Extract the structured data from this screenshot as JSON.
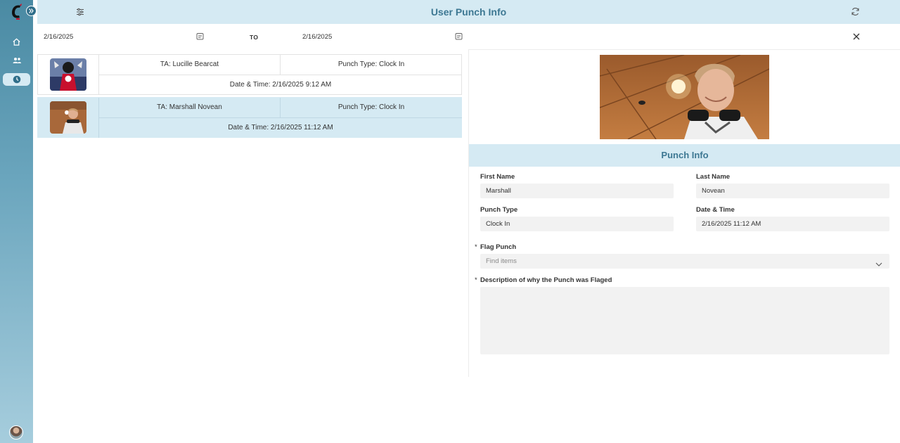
{
  "header": {
    "title": "User Punch Info"
  },
  "date_range": {
    "start": "2/16/2025",
    "to_label": "TO",
    "end": "2/16/2025"
  },
  "punches": [
    {
      "ta": "TA: Lucille Bearcat",
      "punch_type": "Punch Type: Clock In",
      "date_time": "Date & Time: 2/16/2025 9:12 AM",
      "selected": false
    },
    {
      "ta": "TA: Marshall Novean",
      "punch_type": "Punch Type: Clock In",
      "date_time": "Date & Time: 2/16/2025 11:12 AM",
      "selected": true
    }
  ],
  "detail": {
    "section_title": "Punch Info",
    "first_name_label": "First Name",
    "first_name": "Marshall",
    "last_name_label": "Last Name",
    "last_name": "Novean",
    "punch_type_label": "Punch Type",
    "punch_type": "Clock In",
    "date_time_label": "Date & Time",
    "date_time": "2/16/2025 11:12 AM",
    "required_marker": "*",
    "flag_label": "Flag Punch",
    "flag_placeholder": "Find items",
    "description_label": "Description of why the Punch was Flaged",
    "description_value": ""
  },
  "colors": {
    "accent": "#3d7893",
    "header_bg": "#d5eaf3",
    "sidebar": "#4a8aa3"
  },
  "icons": [
    "logo",
    "expand-icon",
    "home-icon",
    "people-icon",
    "clock-icon",
    "filter-icon",
    "refresh-icon",
    "calendar-icon",
    "close-icon",
    "chevron-down-icon"
  ]
}
